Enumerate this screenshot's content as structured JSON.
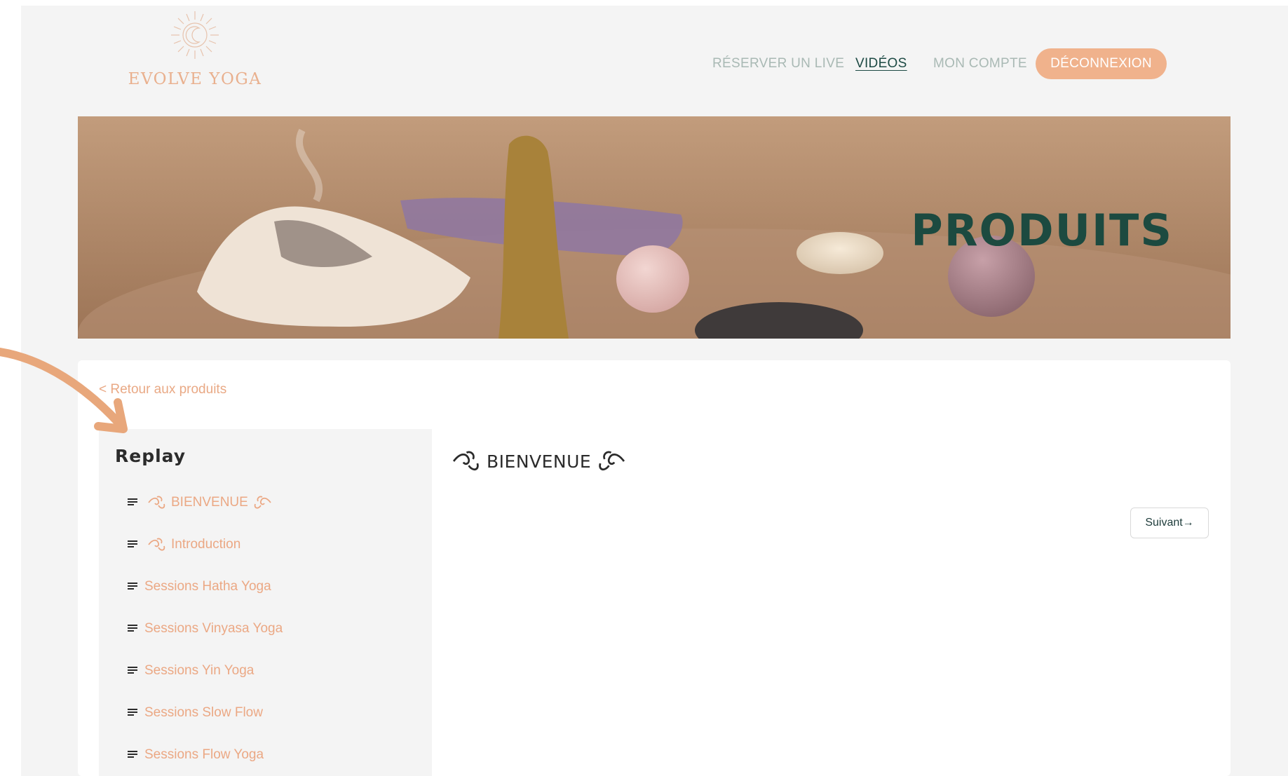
{
  "brand": {
    "name": "EVOLVE YOGA",
    "logo_icon": "moon-sun-icon"
  },
  "nav": {
    "items": [
      {
        "label": "RÉSERVER UN LIVE"
      },
      {
        "label": "VIDÉOS",
        "active": true
      },
      {
        "label": "MON COMPTE"
      }
    ],
    "logout_label": "DÉCONNEXION"
  },
  "banner": {
    "title": "PRODUITS"
  },
  "content": {
    "back_link": "< Retour aux produits",
    "sidebar": {
      "title": "Replay",
      "items": [
        {
          "label": "BIENVENUE",
          "icon_left": "swirl-icon",
          "icon_right": "swirl-icon"
        },
        {
          "label": "Introduction",
          "icon_left": "swirl-icon"
        },
        {
          "label": "Sessions Hatha Yoga"
        },
        {
          "label": "Sessions Vinyasa Yoga"
        },
        {
          "label": "Sessions Yin Yoga"
        },
        {
          "label": "Sessions Slow Flow"
        },
        {
          "label": "Sessions Flow Yoga"
        }
      ]
    },
    "main": {
      "heading": "BIENVENUE",
      "next_label": "Suivant→"
    }
  },
  "colors": {
    "accent": "#f0b28c",
    "link": "#eba884",
    "nav_active": "#1d4a44",
    "banner_title": "#1c4a40"
  }
}
